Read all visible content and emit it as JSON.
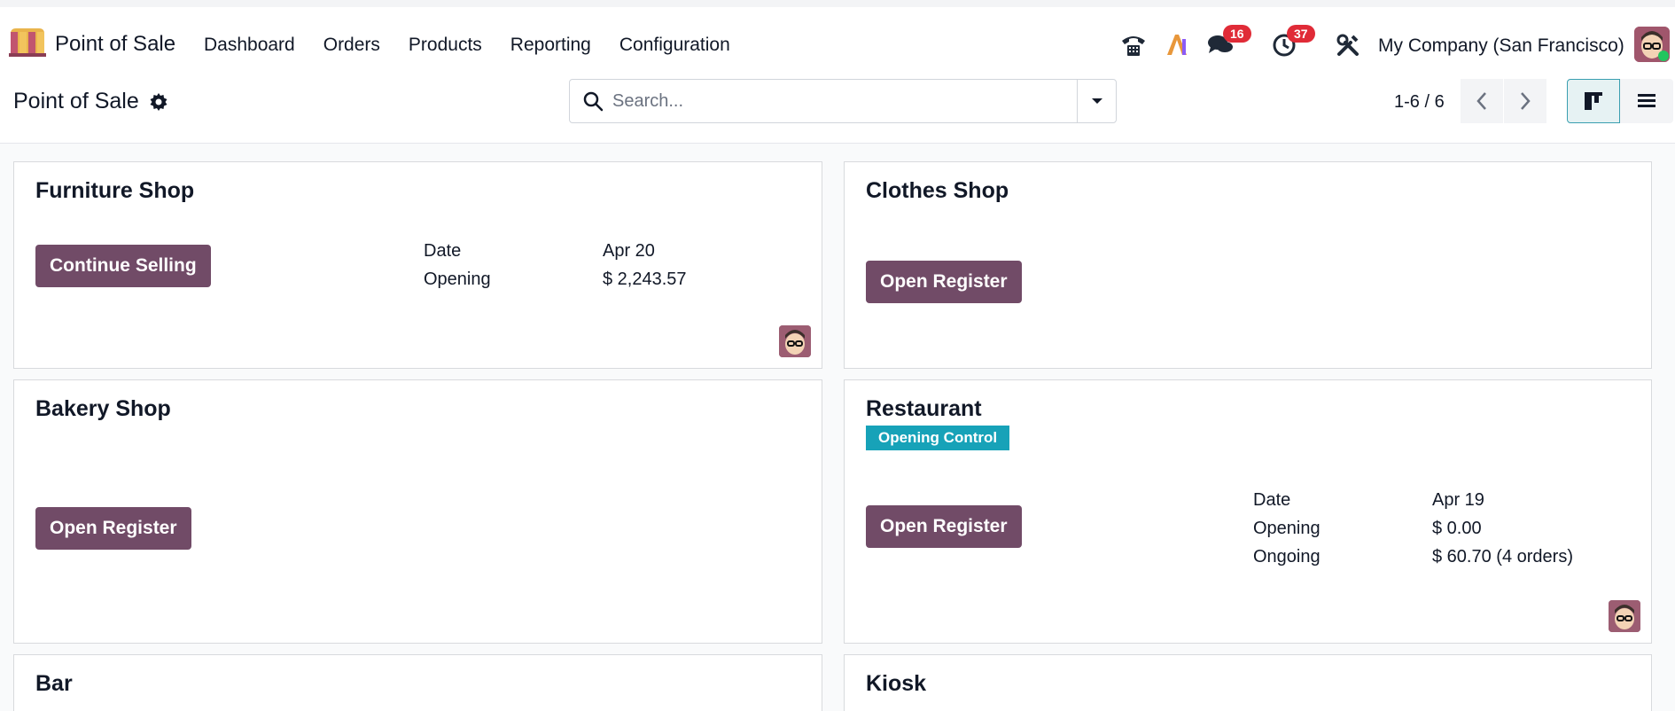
{
  "navbar": {
    "app_name": "Point of Sale",
    "menu": [
      "Dashboard",
      "Orders",
      "Products",
      "Reporting",
      "Configuration"
    ],
    "systray": {
      "messages_count": "16",
      "activities_count": "37",
      "company": "My Company (San Francisco)"
    }
  },
  "control_panel": {
    "breadcrumb": "Point of Sale",
    "search_placeholder": "Search...",
    "pager": "1-6 / 6"
  },
  "cards": [
    {
      "title": "Furniture Shop",
      "button": "Continue Selling",
      "info": [
        {
          "label": "Date",
          "value": "Apr 20"
        },
        {
          "label": "Opening",
          "value": "$ 2,243.57"
        }
      ]
    },
    {
      "title": "Clothes Shop",
      "button": "Open Register"
    },
    {
      "title": "Bakery Shop",
      "button": "Open Register"
    },
    {
      "title": "Restaurant",
      "tag": "Opening Control",
      "button": "Open Register",
      "info": [
        {
          "label": "Date",
          "value": "Apr 19"
        },
        {
          "label": "Opening",
          "value": "$ 0.00"
        },
        {
          "label": "Ongoing",
          "value": "$ 60.70 (4 orders)"
        }
      ]
    },
    {
      "title": "Bar"
    },
    {
      "title": "Kiosk"
    }
  ],
  "colors": {
    "primary": "#714b67",
    "tag": "#17a2b8",
    "badge": "#e02b37"
  },
  "icons": {
    "app_logo": "point-of-sale-logo",
    "breadcrumb_gear": "gear-icon",
    "search": "search-icon",
    "search_toggle": "caret-down-icon",
    "phone": "phone-icon",
    "ai": "ai-icon",
    "messages": "chat-icon",
    "activities": "clock-icon",
    "debug": "tools-icon",
    "pager_prev": "chevron-left-icon",
    "pager_next": "chevron-right-icon",
    "kanban_view": "kanban-icon",
    "list_view": "list-icon"
  }
}
